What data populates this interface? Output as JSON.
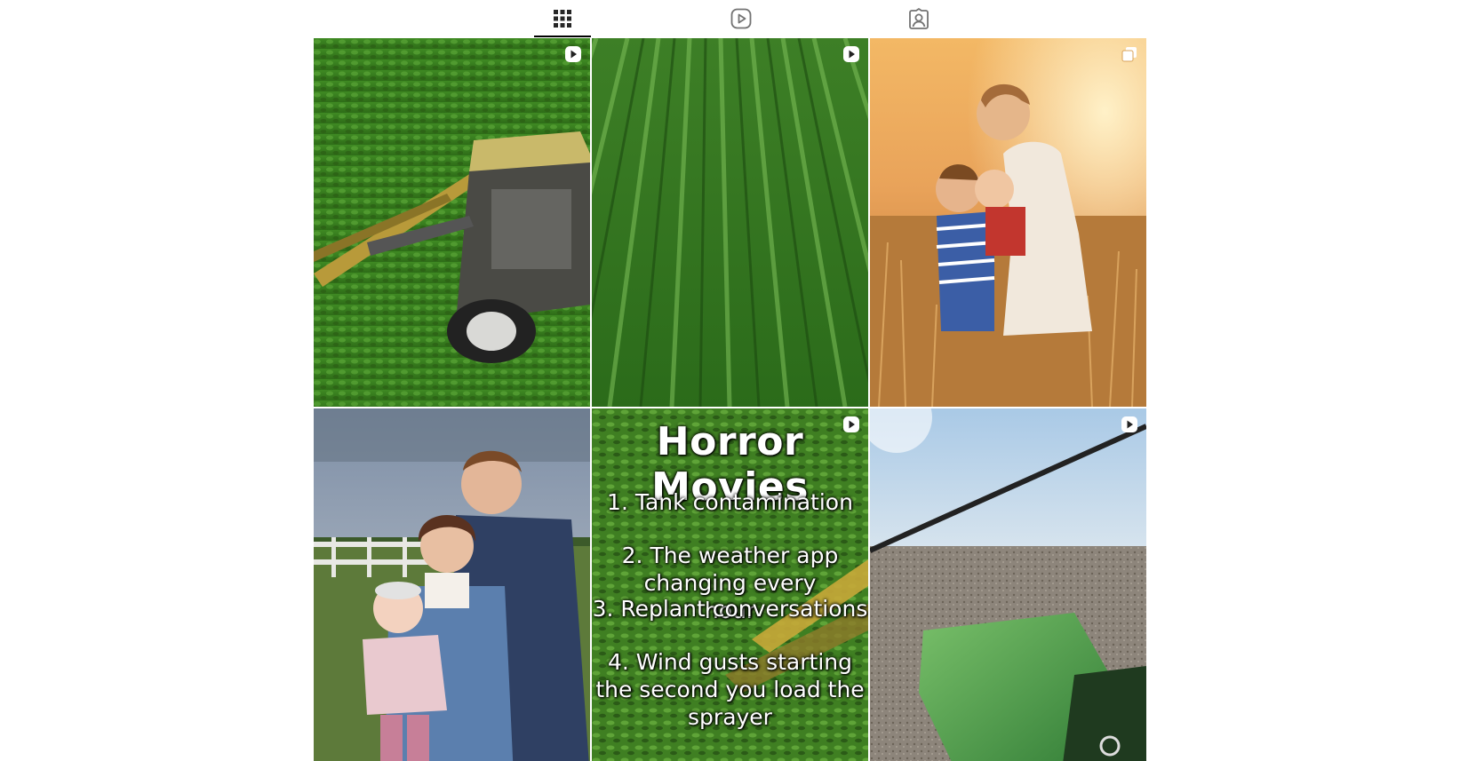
{
  "tabs": [
    {
      "name": "posts",
      "icon": "grid-icon",
      "active": true
    },
    {
      "name": "reels",
      "icon": "reels-icon",
      "active": false
    },
    {
      "name": "tagged",
      "icon": "tagged-icon",
      "active": false
    }
  ],
  "posts": [
    {
      "scene": "sprayer in green bean field",
      "badge": "reel-icon"
    },
    {
      "scene": "aerial cornfield rows",
      "badge": "reel-icon"
    },
    {
      "scene": "mother and children in wheat field",
      "badge": "carousel-icon"
    },
    {
      "scene": "family portrait by fence",
      "badge": "none"
    },
    {
      "scene": "text over field",
      "badge": "reel-icon",
      "overlay": {
        "title": "Horror Movies",
        "lines": [
          "1. Tank contamination",
          "2. The weather app changing every hour",
          "3. Replant conversations",
          "4. Wind gusts starting the second you load the sprayer"
        ]
      }
    },
    {
      "scene": "tractor hood over tilled field",
      "badge": "reel-icon"
    }
  ]
}
